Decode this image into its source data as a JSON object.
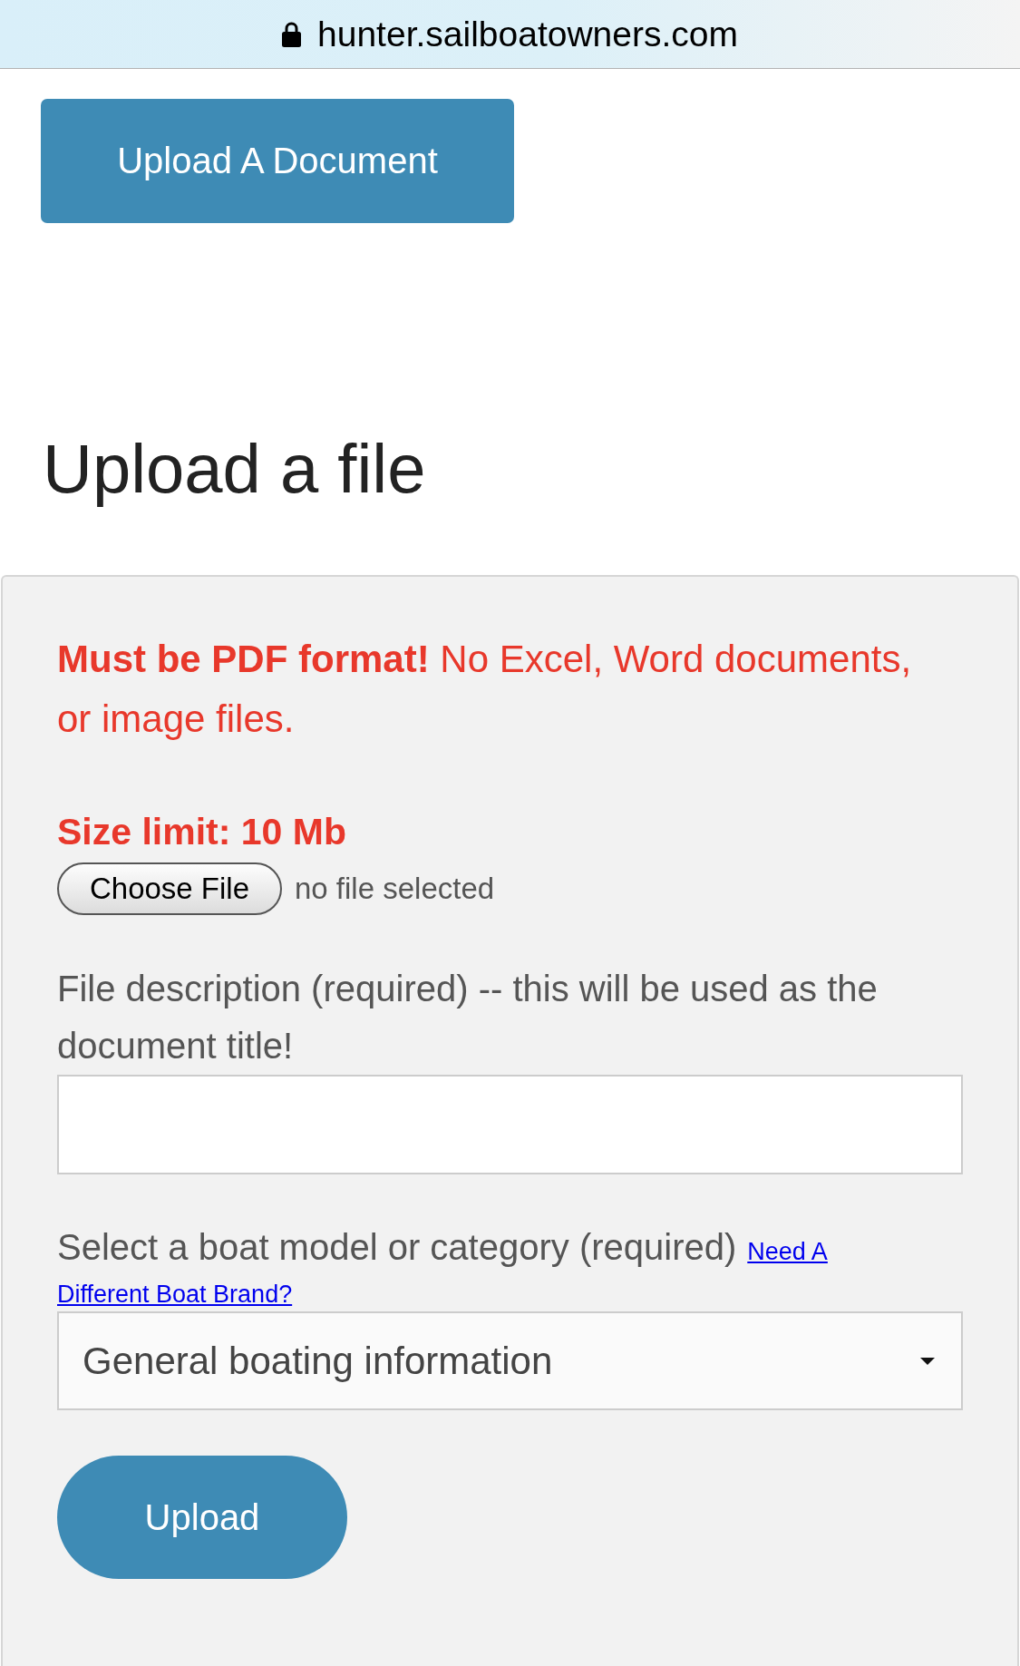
{
  "address_bar": {
    "url": "hunter.sailboatowners.com",
    "secure": true
  },
  "top_button": {
    "label": "Upload A Document"
  },
  "heading": "Upload a file",
  "form": {
    "notice": "**Must be PDF format!** No Excel, Word documents, or image files.",
    "size_limit": "Size limit: 10 Mb",
    "file_input": {
      "button": "Choose File",
      "status": "no file selected"
    },
    "description": {
      "label": "File description (required) -- this will be used as the document title!"
    },
    "boat_select": {
      "label": "Select a boat model or category (required)",
      "link": [
        "Need A",
        "Different Boat Brand?"
      ],
      "value": "General boating information"
    },
    "submit": "Upload"
  }
}
